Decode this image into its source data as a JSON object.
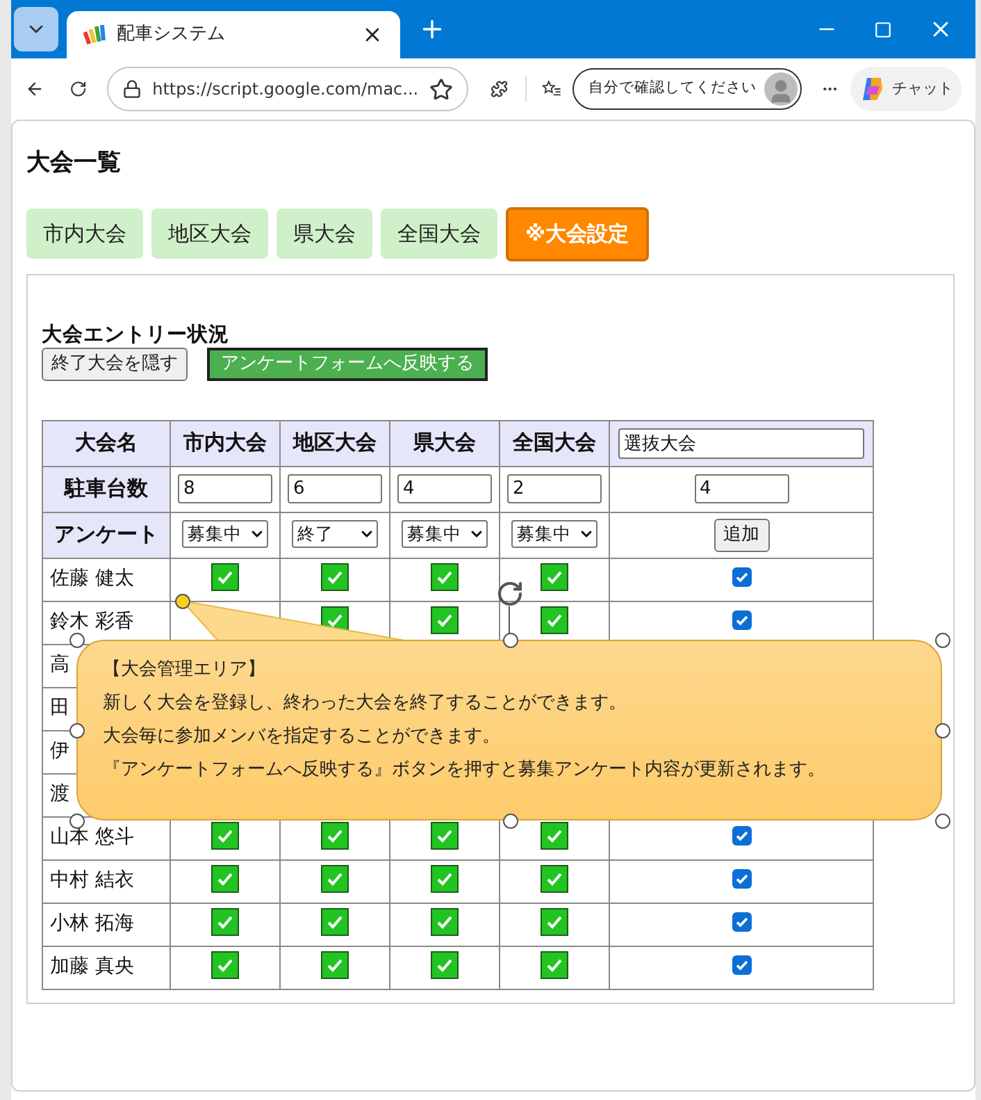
{
  "browser": {
    "tab_title": "配車システム",
    "url": "https://script.google.com/mac...",
    "profile_label": "自分で確認してください",
    "chat_label": "チャット"
  },
  "page": {
    "heading": "大会一覧",
    "tabs": [
      {
        "label": "市内大会",
        "selected": false
      },
      {
        "label": "地区大会",
        "selected": false
      },
      {
        "label": "県大会",
        "selected": false
      },
      {
        "label": "全国大会",
        "selected": false
      },
      {
        "label": "※大会設定",
        "selected": true
      }
    ],
    "section_title": "大会エントリー状況",
    "buttons": [
      {
        "label": "終了大会を隠す",
        "kind": "plain"
      },
      {
        "label": "アンケートフォームへ反映する",
        "kind": "primary"
      }
    ],
    "table": {
      "corner": "大会名",
      "columns": [
        "市内大会",
        "地区大会",
        "県大会",
        "全国大会"
      ],
      "new_column_name": "選抜大会",
      "parking": {
        "label": "駐車台数",
        "values": [
          "8",
          "6",
          "4",
          "2"
        ],
        "new_value": "4"
      },
      "survey": {
        "label": "アンケート",
        "statuses": [
          "募集中",
          "終了",
          "募集中",
          "募集中"
        ],
        "add_button": "追加"
      },
      "rows": [
        {
          "name": "佐藤 健太",
          "checks": [
            true,
            true,
            true,
            true
          ],
          "extra": true
        },
        {
          "name": "鈴木 彩香",
          "checks": [
            true,
            true,
            true
          ],
          "extra": true
        },
        {
          "name": "高"
        },
        {
          "name": "田"
        },
        {
          "name": "伊"
        },
        {
          "name": "渡"
        },
        {
          "name": "山本 悠斗",
          "checks": [
            true,
            true,
            true,
            true
          ],
          "extra": true
        },
        {
          "name": "中村 結衣",
          "checks": [
            true,
            true,
            true,
            true
          ],
          "extra": true
        },
        {
          "name": "小林 拓海",
          "checks": [
            true,
            true,
            true,
            true
          ],
          "extra": true
        },
        {
          "name": "加藤 真央",
          "checks": [
            true,
            true,
            true,
            true
          ],
          "extra": true
        }
      ]
    }
  },
  "callout": {
    "title": "【大会管理エリア】",
    "lines": [
      "新しく大会を登録し、終わった大会を終了することができます。",
      "大会毎に参加メンバを指定することができます。",
      "『アンケートフォームへ反映する』ボタンを押すと募集アンケート内容が更新されます。"
    ]
  }
}
